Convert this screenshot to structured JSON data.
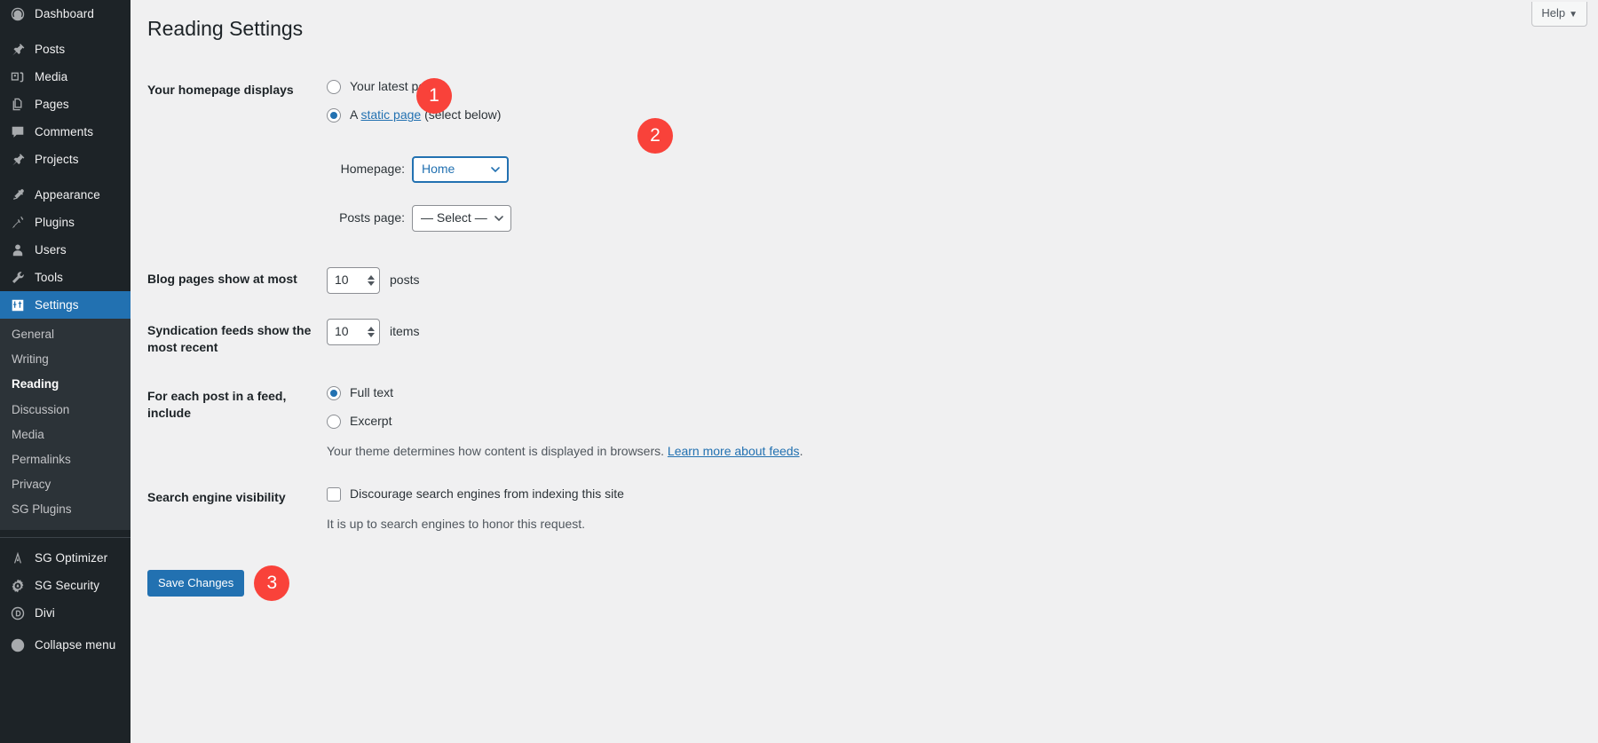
{
  "sidebar": {
    "items": [
      {
        "label": "Dashboard",
        "icon": "dashboard-icon",
        "current": false
      },
      {
        "label": "Posts",
        "icon": "pin-icon",
        "current": false
      },
      {
        "label": "Media",
        "icon": "media-icon",
        "current": false
      },
      {
        "label": "Pages",
        "icon": "pages-icon",
        "current": false
      },
      {
        "label": "Comments",
        "icon": "comments-icon",
        "current": false
      },
      {
        "label": "Projects",
        "icon": "pin-icon",
        "current": false
      },
      {
        "label": "Appearance",
        "icon": "appearance-icon",
        "current": false
      },
      {
        "label": "Plugins",
        "icon": "plugins-icon",
        "current": false
      },
      {
        "label": "Users",
        "icon": "users-icon",
        "current": false
      },
      {
        "label": "Tools",
        "icon": "tools-icon",
        "current": false
      },
      {
        "label": "Settings",
        "icon": "settings-icon",
        "current": true
      }
    ],
    "submenu": [
      {
        "label": "General",
        "current": false
      },
      {
        "label": "Writing",
        "current": false
      },
      {
        "label": "Reading",
        "current": true
      },
      {
        "label": "Discussion",
        "current": false
      },
      {
        "label": "Media",
        "current": false
      },
      {
        "label": "Permalinks",
        "current": false
      },
      {
        "label": "Privacy",
        "current": false
      },
      {
        "label": "SG Plugins",
        "current": false
      }
    ],
    "plugins": [
      {
        "label": "SG Optimizer",
        "icon": "sg-optimizer-icon"
      },
      {
        "label": "SG Security",
        "icon": "sg-security-icon"
      },
      {
        "label": "Divi",
        "icon": "divi-icon"
      }
    ],
    "collapse": {
      "label": "Collapse menu",
      "icon": "collapse-left-icon"
    }
  },
  "header": {
    "help_label": "Help",
    "help_caret": "▼",
    "page_title": "Reading Settings"
  },
  "form": {
    "homepage_displays": {
      "label": "Your homepage displays",
      "option_latest": "Your latest posts",
      "option_static_prefix": "A ",
      "option_static_link": "static page",
      "option_static_suffix": " (select below)",
      "selected": "static",
      "homepage_label": "Homepage:",
      "homepage_value": "Home",
      "posts_page_label": "Posts page:",
      "posts_page_value": "— Select —"
    },
    "blog_pages": {
      "label": "Blog pages show at most",
      "value": "10",
      "unit": "posts"
    },
    "syndication": {
      "label": "Syndication feeds show the most recent",
      "value": "10",
      "unit": "items"
    },
    "feed_include": {
      "label": "For each post in a feed, include",
      "option_full": "Full text",
      "option_excerpt": "Excerpt",
      "selected": "full",
      "desc_prefix": "Your theme determines how content is displayed in browsers. ",
      "desc_link": "Learn more about feeds",
      "desc_suffix": "."
    },
    "search_visibility": {
      "label": "Search engine visibility",
      "checkbox_label": "Discourage search engines from indexing this site",
      "checked": false,
      "desc": "It is up to search engines to honor this request."
    },
    "submit_label": "Save Changes"
  },
  "badges": {
    "one": "1",
    "two": "2",
    "three": "3",
    "color": "#f9423a"
  }
}
